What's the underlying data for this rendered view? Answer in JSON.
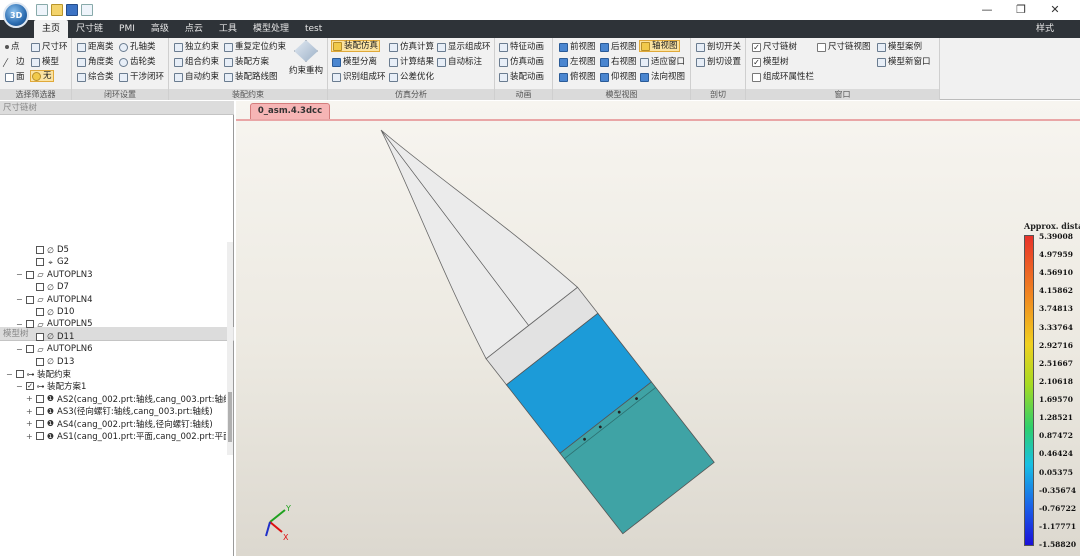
{
  "titlebar": {
    "minimize": "—",
    "restore": "❐",
    "close": "✕",
    "logo_text": "3D"
  },
  "menu": {
    "tabs": [
      "主页",
      "尺寸链",
      "PMI",
      "高级",
      "点云",
      "工具",
      "模型处理",
      "test"
    ],
    "active_tab": "主页",
    "style_label": "样式"
  },
  "ribbon": {
    "groups": {
      "filter": {
        "label": "选择筛选器",
        "point": "点",
        "dim_ring": "尺寸环",
        "edge": "边",
        "model": "模型",
        "face": "面",
        "none": "无"
      },
      "loop": {
        "label": "闭环设置",
        "distance": "距离类",
        "hole_axis": "孔轴类",
        "angle": "角度类",
        "gear": "齿轮类",
        "composite": "综合类",
        "interference": "干涉闭环"
      },
      "assembly": {
        "label": "装配约束",
        "independent": "独立约束",
        "relocate": "重复定位约束",
        "combined": "组合约束",
        "plan": "装配方案",
        "auto": "自动约束",
        "route": "装配路线图",
        "rebuild": "约束重构"
      },
      "simulation": {
        "label": "仿真分析",
        "assembly_sim": "装配仿真",
        "sim_calc": "仿真计算",
        "show_ring": "显示组成环",
        "model_split": "模型分离",
        "calc_result": "计算结果",
        "auto_mark": "自动标注",
        "identify_ring": "识别组成环",
        "tolerance_opt": "公差优化"
      },
      "animation": {
        "label": "动画",
        "feature": "特征动画",
        "sim": "仿真动画",
        "assembly": "装配动画"
      },
      "views": {
        "label": "模型视图",
        "front": "前视图",
        "back": "后视图",
        "axis": "轴视图",
        "left": "左视图",
        "right": "右视图",
        "fit": "适应窗口",
        "top": "俯视图",
        "bottom": "仰视图",
        "normal": "法向视图"
      },
      "section": {
        "label": "剖切",
        "switch": "剖切开关",
        "settings": "剖切设置"
      },
      "window": {
        "label": "窗口",
        "dim_tree": "尺寸链树",
        "dim_view": "尺寸链视图",
        "model_case": "模型案例",
        "model_tree": "模型树",
        "model_window": "模型新窗口",
        "ring_props": "组成环属性栏"
      }
    }
  },
  "left_panel": {
    "dim_chain_header": "尺寸链树",
    "model_tree_header": "模型树",
    "tree": [
      {
        "label": "D5",
        "icon": "diameter-icon",
        "depth": 2,
        "toggle": ""
      },
      {
        "label": "G2",
        "icon": "position-icon",
        "depth": 2,
        "toggle": ""
      },
      {
        "label": "AUTOPLN3",
        "icon": "plane-icon",
        "depth": 1,
        "toggle": "−"
      },
      {
        "label": "D7",
        "icon": "diameter-icon",
        "depth": 2,
        "toggle": ""
      },
      {
        "label": "AUTOPLN4",
        "icon": "plane-icon",
        "depth": 1,
        "toggle": "−"
      },
      {
        "label": "D10",
        "icon": "diameter-icon",
        "depth": 2,
        "toggle": ""
      },
      {
        "label": "AUTOPLN5",
        "icon": "plane-icon",
        "depth": 1,
        "toggle": "−"
      },
      {
        "label": "D11",
        "icon": "diameter-icon",
        "depth": 2,
        "toggle": ""
      },
      {
        "label": "AUTOPLN6",
        "icon": "plane-icon",
        "depth": 1,
        "toggle": "−"
      },
      {
        "label": "D13",
        "icon": "diameter-icon",
        "depth": 2,
        "toggle": ""
      },
      {
        "label": "装配约束",
        "icon": "assembly-icon",
        "depth": 0,
        "toggle": "−"
      },
      {
        "label": "装配方案1",
        "icon": "assembly-icon",
        "depth": 1,
        "toggle": "−",
        "checked": true
      },
      {
        "label": "AS2(cang_002.prt:轴线,cang_003.prt:轴线)",
        "icon": "info-icon",
        "depth": 2,
        "toggle": "+"
      },
      {
        "label": "AS3(径向螺钉:轴线,cang_003.prt:轴线)",
        "icon": "info-icon",
        "depth": 2,
        "toggle": "+"
      },
      {
        "label": "AS4(cang_002.prt:轴线,径向螺钉:轴线)",
        "icon": "info-icon",
        "depth": 2,
        "toggle": "+"
      },
      {
        "label": "AS1(cang_001.prt:平面,cang_002.prt:平面)",
        "icon": "info-icon",
        "depth": 2,
        "toggle": "+"
      }
    ]
  },
  "viewport": {
    "doc_tab": "0_asm.4.3dcc",
    "triad": {
      "x_label": "X",
      "y_label": "Y"
    },
    "colors": {
      "white_body": "#e9e9e9",
      "blue_band": "#1c9bd8",
      "teal_band": "#3fa3a5"
    }
  },
  "legend": {
    "title": "Approx. distance",
    "ticks": [
      "5.39008",
      "4.97959",
      "4.56910",
      "4.15862",
      "3.74813",
      "3.33764",
      "2.92716",
      "2.51667",
      "2.10618",
      "1.69570",
      "1.28521",
      "0.87472",
      "0.46424",
      "0.05375",
      "-0.35674",
      "-0.76722",
      "-1.17771",
      "-1.58820"
    ]
  }
}
